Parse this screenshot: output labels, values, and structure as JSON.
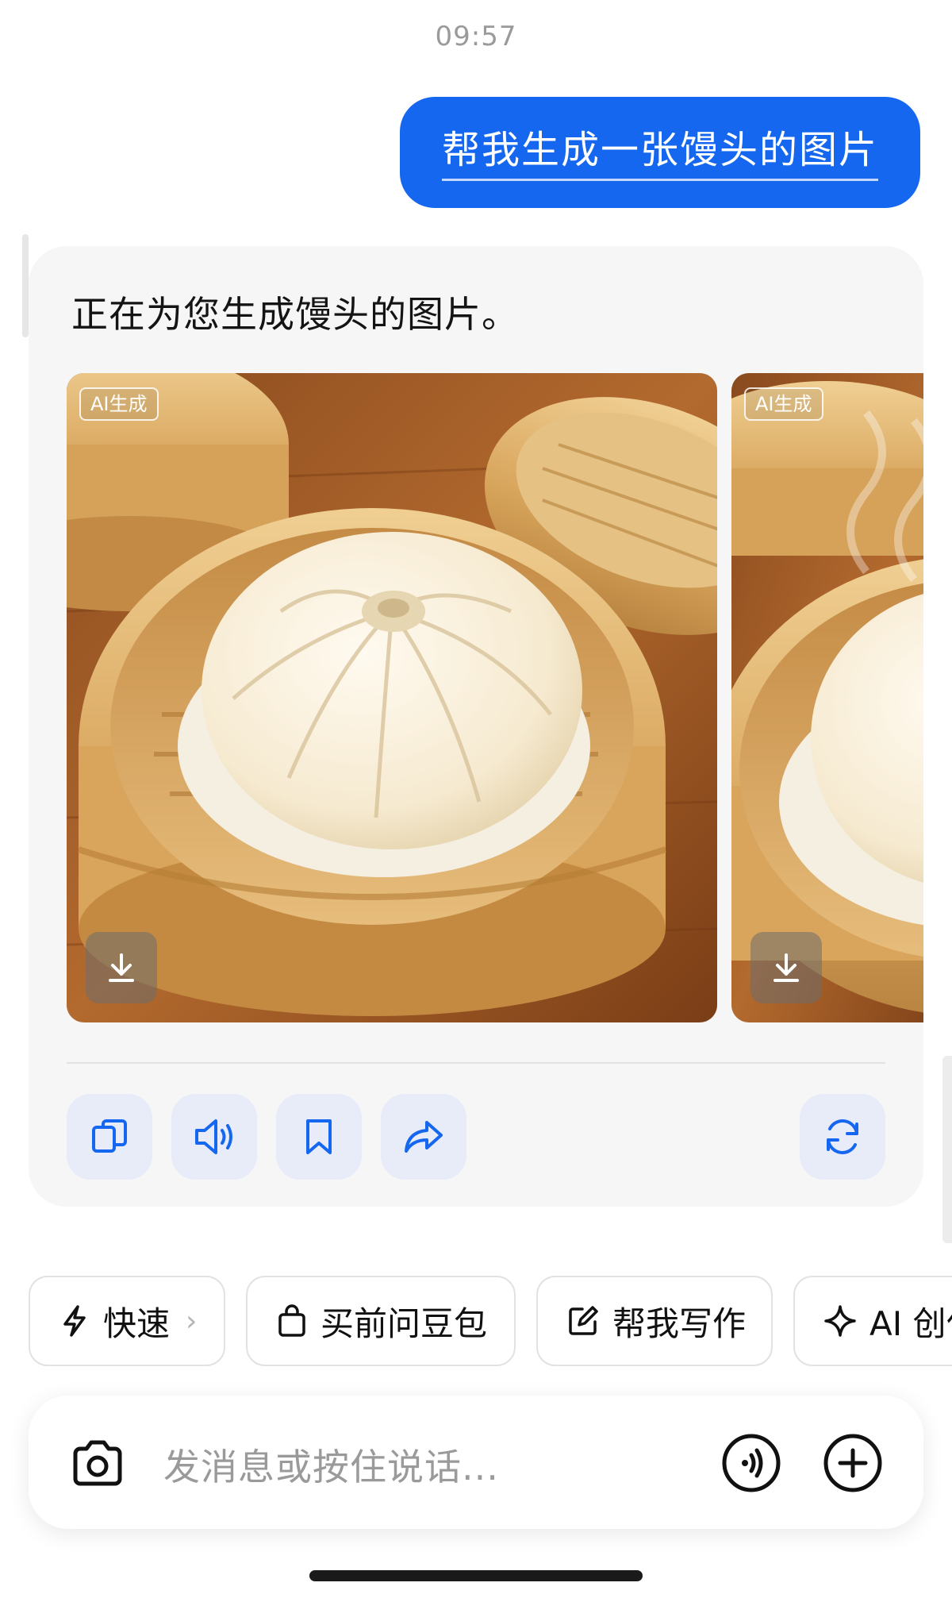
{
  "timestamp": "09:57",
  "user_message": "帮我生成一张馒头的图片",
  "ai_message": "正在为您生成馒头的图片。",
  "images": [
    {
      "badge": "AI生成",
      "subject": "steamed bun in bamboo steamer"
    },
    {
      "badge": "AI生成",
      "subject": "steamed bun in bamboo steamer with steam"
    }
  ],
  "actions": {
    "copy": "copy-icon",
    "read_aloud": "speaker-icon",
    "bookmark": "bookmark-icon",
    "share": "share-icon",
    "regenerate": "refresh-icon"
  },
  "chips": [
    {
      "label": "快速",
      "icon": "lightning-icon",
      "chevron": "›"
    },
    {
      "label": "买前问豆包",
      "icon": "shopping-bag-icon"
    },
    {
      "label": "帮我写作",
      "icon": "edit-icon"
    },
    {
      "label": "AI 创作",
      "icon": "sparkle-icon"
    }
  ],
  "input": {
    "placeholder": "发消息或按住说话..."
  },
  "colors": {
    "accent": "#1567f0",
    "card_bg": "#f6f6f7",
    "action_bg": "#e7ecf8"
  }
}
